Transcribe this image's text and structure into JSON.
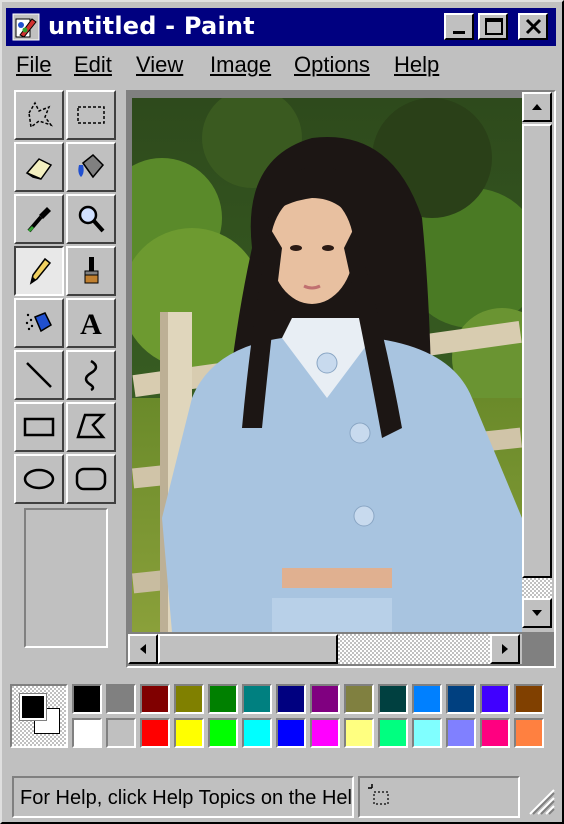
{
  "window": {
    "title": "untitled - Paint",
    "title_icon": "paint-app-icon",
    "controls": [
      "minimize-icon",
      "maximize-icon",
      "close-icon"
    ]
  },
  "menu": {
    "items": [
      {
        "label": "File"
      },
      {
        "label": "Edit"
      },
      {
        "label": "View"
      },
      {
        "label": "Image"
      },
      {
        "label": "Options"
      },
      {
        "label": "Help"
      }
    ]
  },
  "tools": [
    {
      "name": "free-form-select-icon",
      "active": false
    },
    {
      "name": "rect-select-icon",
      "active": false
    },
    {
      "name": "eraser-icon",
      "active": false
    },
    {
      "name": "fill-bucket-icon",
      "active": false
    },
    {
      "name": "eyedropper-icon",
      "active": false
    },
    {
      "name": "magnifier-icon",
      "active": false
    },
    {
      "name": "pencil-icon",
      "active": true
    },
    {
      "name": "brush-icon",
      "active": false
    },
    {
      "name": "airbrush-icon",
      "active": false
    },
    {
      "name": "text-icon",
      "active": false,
      "glyph": "A"
    },
    {
      "name": "line-icon",
      "active": false
    },
    {
      "name": "curve-icon",
      "active": false
    },
    {
      "name": "rectangle-icon",
      "active": false
    },
    {
      "name": "polygon-icon",
      "active": false
    },
    {
      "name": "ellipse-icon",
      "active": false
    },
    {
      "name": "rounded-rectangle-icon",
      "active": false
    }
  ],
  "canvas": {
    "content": "photo of a person in a light blue outfit in front of a wooden fence and trees"
  },
  "palette": {
    "foreground": "#000000",
    "background": "#ffffff",
    "colors_top": [
      "#000000",
      "#808080",
      "#800000",
      "#808000",
      "#008000",
      "#008080",
      "#000080",
      "#800080",
      "#808040",
      "#004040",
      "#0080ff",
      "#004080",
      "#4000ff",
      "#804000"
    ],
    "colors_bottom": [
      "#ffffff",
      "#c0c0c0",
      "#ff0000",
      "#ffff00",
      "#00ff00",
      "#00ffff",
      "#0000ff",
      "#ff00ff",
      "#ffff80",
      "#00ff80",
      "#80ffff",
      "#8080ff",
      "#ff0080",
      "#ff8040"
    ]
  },
  "status": {
    "help_text": "For Help, click Help Topics on the Help Menu.",
    "coordinates": ""
  }
}
